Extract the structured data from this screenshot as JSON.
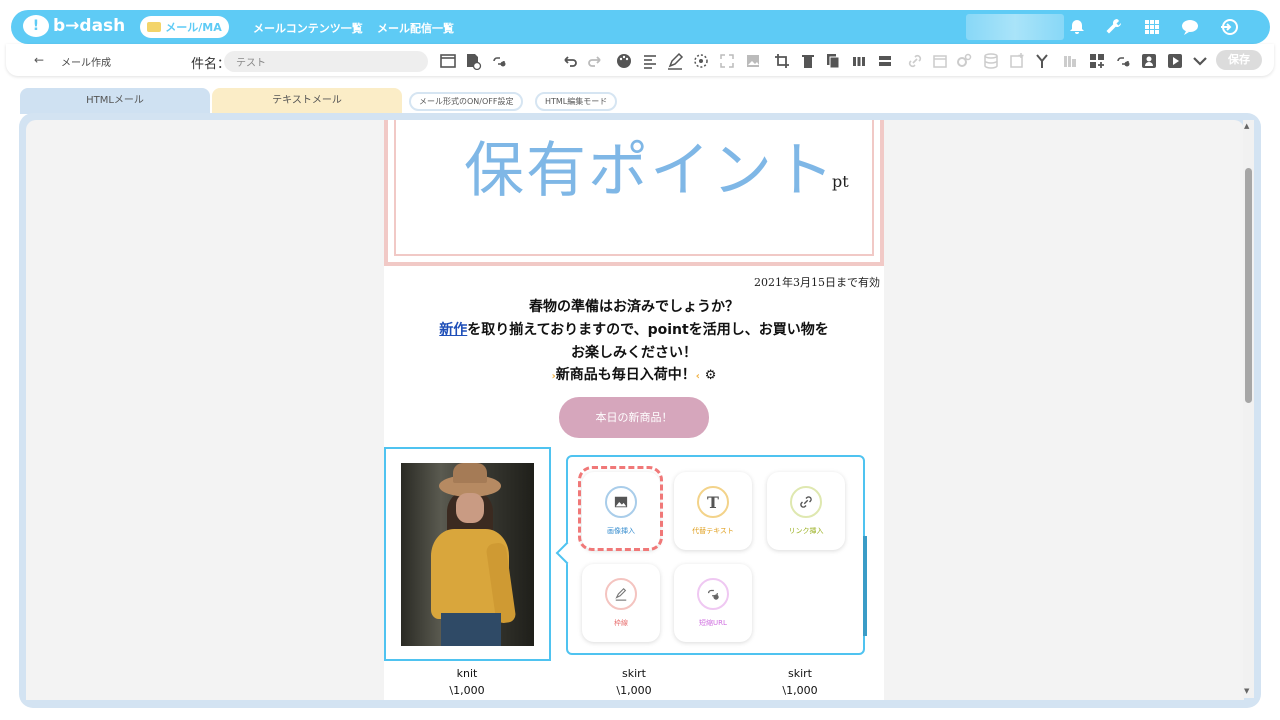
{
  "app": {
    "logo_text": "b→dash",
    "mode_label": "メール/MA",
    "nav_links": [
      "メールコンテンツ一覧",
      "メール配信一覧"
    ]
  },
  "toolbar": {
    "back_label": "メール作成",
    "subject_label": "件名：",
    "subject_value": "テスト",
    "save_label": "保存"
  },
  "tabs": {
    "html": "HTMLメール",
    "text": "テキストメール",
    "toggle_format": "メール形式のON/OFF設定",
    "html_edit_mode": "HTML編集モード"
  },
  "mail": {
    "points_title": "保有ポイント",
    "points_unit": "pt",
    "valid_until": "2021年3月15日まで有効",
    "line1": "春物の準備はお済みでしょうか？",
    "line2_link": "新作",
    "line2_rest": "を取り揃えておりますので、pointを活用し、お買い物を",
    "line3": "お楽しみください！",
    "line4": "新商品も毎日入荷中！",
    "cta": "本日の新商品！",
    "products": [
      {
        "name": "knit",
        "price": "\\1,000"
      },
      {
        "name": "skirt",
        "price": "\\1,000"
      },
      {
        "name": "skirt",
        "price": "\\1,000"
      }
    ]
  },
  "popover": {
    "insert_image": "画像挿入",
    "alt_text": "代替テキスト",
    "insert_link": "リンク挿入",
    "border": "枠線",
    "short_url": "短縮URL"
  },
  "colors": {
    "brand": "#5ecbf5",
    "accent_pink": "#d6a6bc",
    "points_blue": "#7fb7e6"
  }
}
